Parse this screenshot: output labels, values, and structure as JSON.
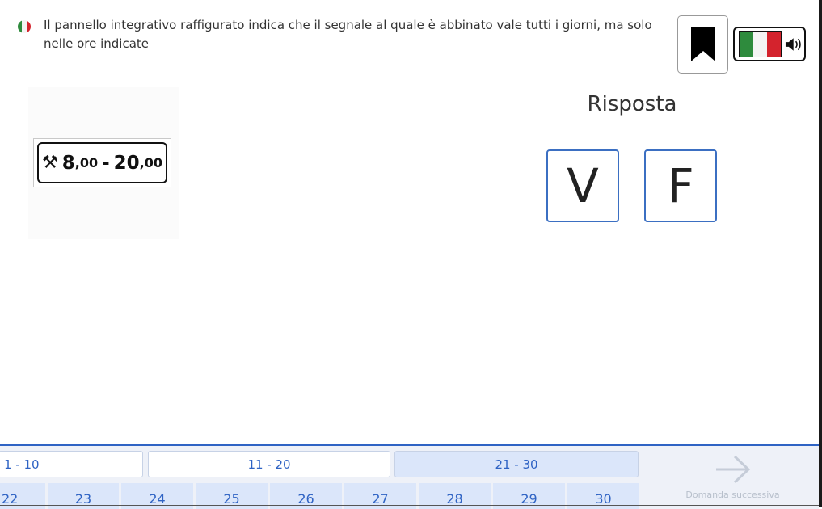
{
  "question": {
    "text": "Il pannello integrativo raffigurato indica che il segnale al quale è abbinato vale tutti i giorni, ma solo nelle ore indicate"
  },
  "flag_colors": [
    "#2e8b3d",
    "#f4f4f4",
    "#d4232d"
  ],
  "sign": {
    "icon": "⚒",
    "start_main": "8",
    "start_decimals": ",00",
    "separator": "-",
    "end_main": "20",
    "end_decimals": ",00"
  },
  "answer": {
    "title": "Risposta",
    "true_label": "V",
    "false_label": "F"
  },
  "ranges": [
    {
      "label": "1 - 10",
      "active": false
    },
    {
      "label": "11 - 20",
      "active": false
    },
    {
      "label": "21 - 30",
      "active": true
    }
  ],
  "question_numbers": [
    "22",
    "23",
    "24",
    "25",
    "26",
    "27",
    "28",
    "29",
    "30"
  ],
  "next": {
    "label": "Domanda successiva"
  },
  "colors": {
    "accent": "#2f63c4",
    "tab_bg": "#dbe6fa",
    "bar_bg": "#eef1f8"
  }
}
